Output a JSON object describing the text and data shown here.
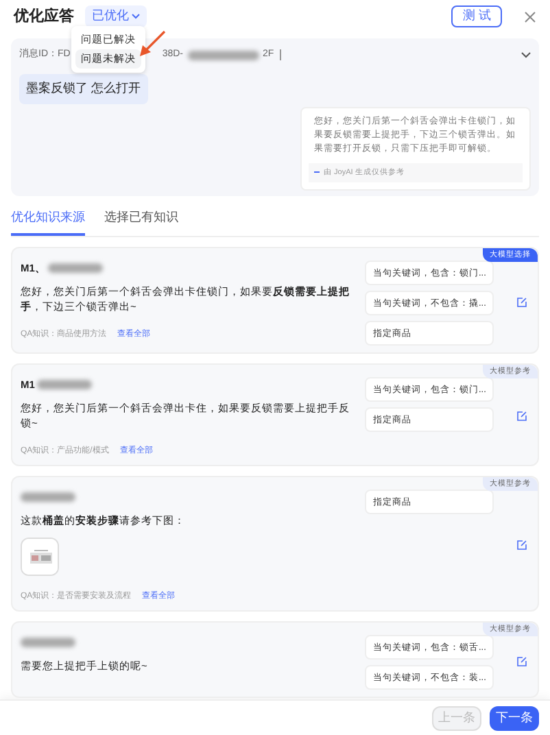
{
  "header": {
    "title": "优化应答",
    "status": "已优化",
    "test_button": "测 试"
  },
  "status_menu": {
    "items": [
      {
        "label": "问题已解决",
        "selected": false
      },
      {
        "label": "问题未解决",
        "selected": true
      }
    ]
  },
  "message": {
    "id_label": "消息ID：FD",
    "id_mid": "38D-",
    "id_end": "2F",
    "question": "墨案反锁了 怎么打开",
    "answer": "您好，您关门后第一个斜舌会弹出卡住锁门，如果要反锁需要上提把手，下边三个锁舌弹出。如果需要打开反锁，只需下压把手即可解锁。",
    "answer_note": "由 JoyAI 生成仅供参考"
  },
  "tabs": [
    {
      "label": "优化知识来源",
      "selected": true
    },
    {
      "label": "选择已有知识",
      "selected": false
    }
  ],
  "cards": [
    {
      "title": "M1、",
      "badge": {
        "label": "大模型选择",
        "selected": true
      },
      "text": "您好，您关门后第一个斜舌会弹出卡住锁门，如果要**反锁需要上提把手**，下边三个锁舌弹出~",
      "qa_label": "QA知识：商品使用方法",
      "qa_link": "查看全部",
      "conditions": [
        "当句关键词，包含：锁门...",
        "当句关键词，不包含：撬...",
        "指定商品"
      ]
    },
    {
      "title": "M1",
      "badge": {
        "label": "大模型参考",
        "selected": false
      },
      "text": "您好，您关门后第一个斜舌会弹出卡住，如果要反锁需要上提把手反锁~",
      "qa_label": "QA知识：产品功能/模式",
      "qa_link": "查看全部",
      "conditions": [
        "当句关键词，包含：锁门...",
        "指定商品"
      ]
    },
    {
      "badge": {
        "label": "大模型参考",
        "selected": false
      },
      "text": "这款**桶盖**的**安装步骤**请参考下图：",
      "image": {
        "kind": "picture"
      },
      "qa_label": "QA知识：是否需要安装及流程",
      "qa_link": "查看全部",
      "conditions": [
        "指定商品"
      ]
    },
    {
      "badge": {
        "label": "大模型参考",
        "selected": false
      },
      "text": "需要您上提把手上锁的呢~",
      "conditions": [
        "当句关键词，包含：锁舌...",
        "当句关键词，不包含：装..."
      ]
    }
  ],
  "footer": {
    "prev": {
      "label": "上一条",
      "disabled": true
    },
    "next": {
      "label": "下一条",
      "disabled": false
    }
  }
}
